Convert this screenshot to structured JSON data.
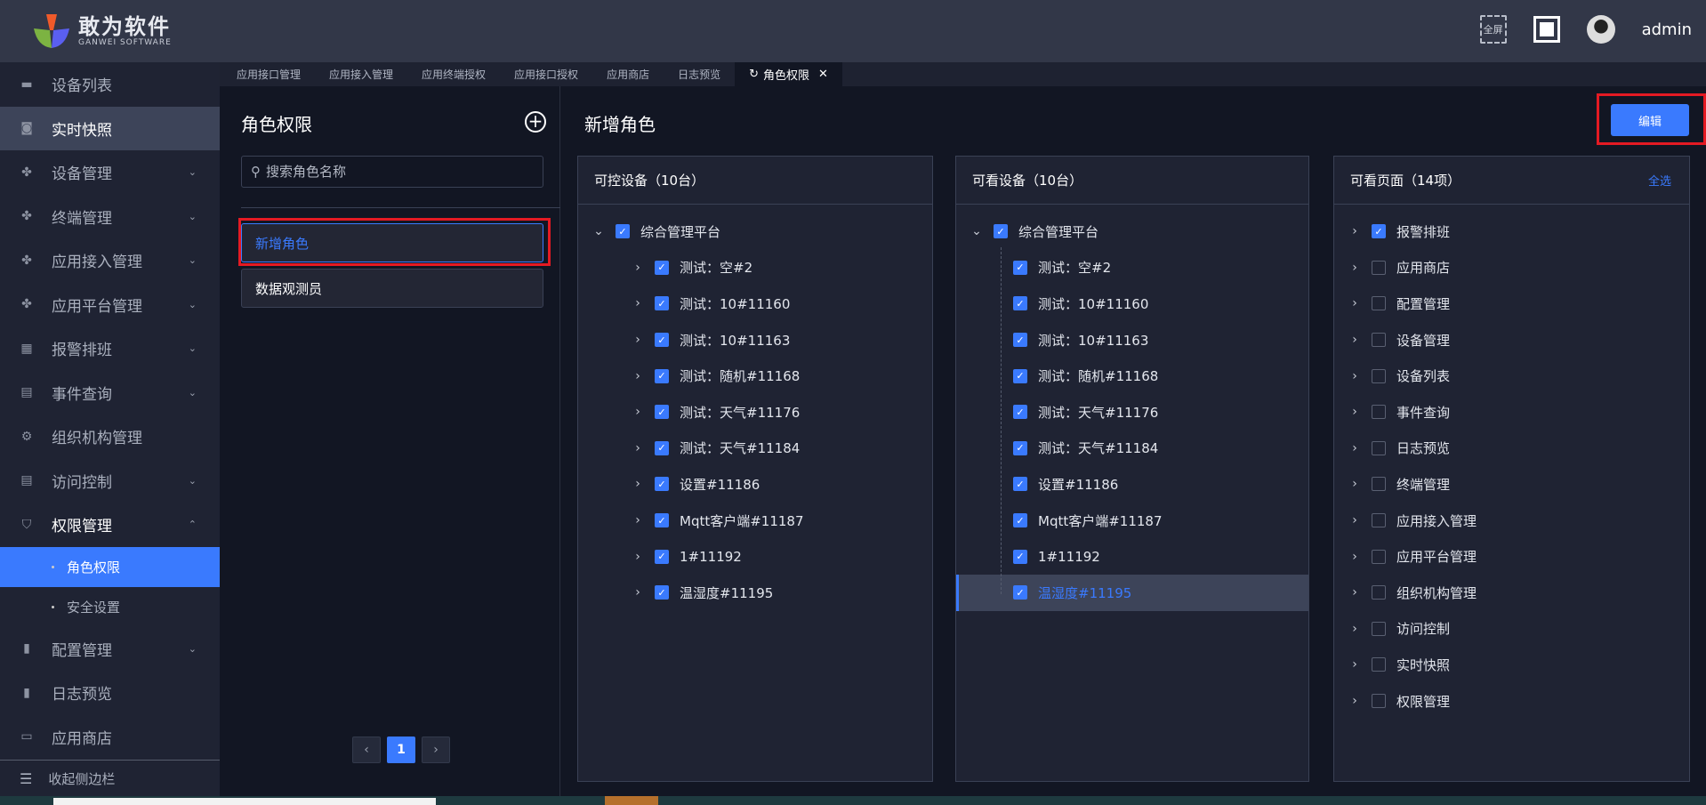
{
  "header": {
    "logo_cn": "敢为软件",
    "logo_en": "GANWEI SOFTWARE",
    "fullscreen_label": "全屏",
    "username": "admin"
  },
  "tabs": [
    {
      "label": "应用接口管理"
    },
    {
      "label": "应用接入管理"
    },
    {
      "label": "应用终端授权"
    },
    {
      "label": "应用接口授权"
    },
    {
      "label": "应用商店"
    },
    {
      "label": "日志预览"
    },
    {
      "label": "角色权限",
      "active": true,
      "close": "✕",
      "refresh": "↻"
    }
  ],
  "sidebar": {
    "items": [
      {
        "label": "设备列表",
        "icon": "monitor-icon",
        "glyph": "▬"
      },
      {
        "label": "实时快照",
        "icon": "camera-icon",
        "glyph": "◙",
        "highlight": true
      },
      {
        "label": "设备管理",
        "icon": "grid-icon",
        "glyph": "✤",
        "chevron": "⌄"
      },
      {
        "label": "终端管理",
        "icon": "grid-icon",
        "glyph": "✤",
        "chevron": "⌄"
      },
      {
        "label": "应用接入管理",
        "icon": "grid-icon",
        "glyph": "✤",
        "chevron": "⌄"
      },
      {
        "label": "应用平台管理",
        "icon": "grid-icon",
        "glyph": "✤",
        "chevron": "⌄"
      },
      {
        "label": "报警排班",
        "icon": "calendar-icon",
        "glyph": "▦",
        "chevron": "⌄"
      },
      {
        "label": "事件查询",
        "icon": "document-search-icon",
        "glyph": "▤",
        "chevron": "⌄"
      },
      {
        "label": "组织机构管理",
        "icon": "gear-icon",
        "glyph": "⚙"
      },
      {
        "label": "访问控制",
        "icon": "list-icon",
        "glyph": "▤",
        "chevron": "⌄"
      },
      {
        "label": "权限管理",
        "icon": "shield-icon",
        "glyph": "⛉",
        "chevron": "⌃",
        "open": true
      }
    ],
    "sub_items": [
      {
        "label": "角色权限",
        "active": true
      },
      {
        "label": "安全设置"
      }
    ],
    "items_after": [
      {
        "label": "配置管理",
        "icon": "bookmark-icon",
        "glyph": "▮",
        "chevron": "⌄"
      },
      {
        "label": "日志预览",
        "icon": "log-icon",
        "glyph": "▮"
      },
      {
        "label": "应用商店",
        "icon": "store-icon",
        "glyph": "▭"
      }
    ],
    "collapse_label": "收起侧边栏"
  },
  "roles_panel": {
    "title": "角色权限",
    "search_placeholder": "搜索角色名称",
    "roles": [
      "新增角色",
      "数据观测员"
    ],
    "current_page": "1",
    "prev": "‹",
    "next": "›"
  },
  "main": {
    "title": "新增角色",
    "edit_label": "编辑"
  },
  "controllable": {
    "title": "可控设备（10台）",
    "root": "综合管理平台",
    "items": [
      "测试：空#2",
      "测试：10#11160",
      "测试：10#11163",
      "测试：随机#11168",
      "测试：天气#11176",
      "测试：天气#11184",
      "设置#11186",
      "Mqtt客户端#11187",
      "1#11192",
      "温湿度#11195"
    ]
  },
  "viewable": {
    "title": "可看设备（10台）",
    "root": "综合管理平台",
    "items": [
      "测试：空#2",
      "测试：10#11160",
      "测试：10#11163",
      "测试：随机#11168",
      "测试：天气#11176",
      "测试：天气#11184",
      "设置#11186",
      "Mqtt客户端#11187",
      "1#11192",
      "温湿度#11195"
    ],
    "current_item": "温湿度#11195"
  },
  "pages": {
    "title": "可看页面（14项）",
    "select_all": "全选",
    "items": [
      {
        "label": "报警排班",
        "checked": true
      },
      {
        "label": "应用商店",
        "checked": false
      },
      {
        "label": "配置管理",
        "checked": false
      },
      {
        "label": "设备管理",
        "checked": false
      },
      {
        "label": "设备列表",
        "checked": false
      },
      {
        "label": "事件查询",
        "checked": false
      },
      {
        "label": "日志预览",
        "checked": false
      },
      {
        "label": "终端管理",
        "checked": false
      },
      {
        "label": "应用接入管理",
        "checked": false
      },
      {
        "label": "应用平台管理",
        "checked": false
      },
      {
        "label": "组织机构管理",
        "checked": false
      },
      {
        "label": "访问控制",
        "checked": false
      },
      {
        "label": "实时快照",
        "checked": false
      },
      {
        "label": "权限管理",
        "checked": false
      }
    ]
  },
  "colors": {
    "accent": "#3a7afe",
    "header_bg": "#323748",
    "sidebar_bg": "#1f2333",
    "highlight_box": "#e41a23"
  }
}
